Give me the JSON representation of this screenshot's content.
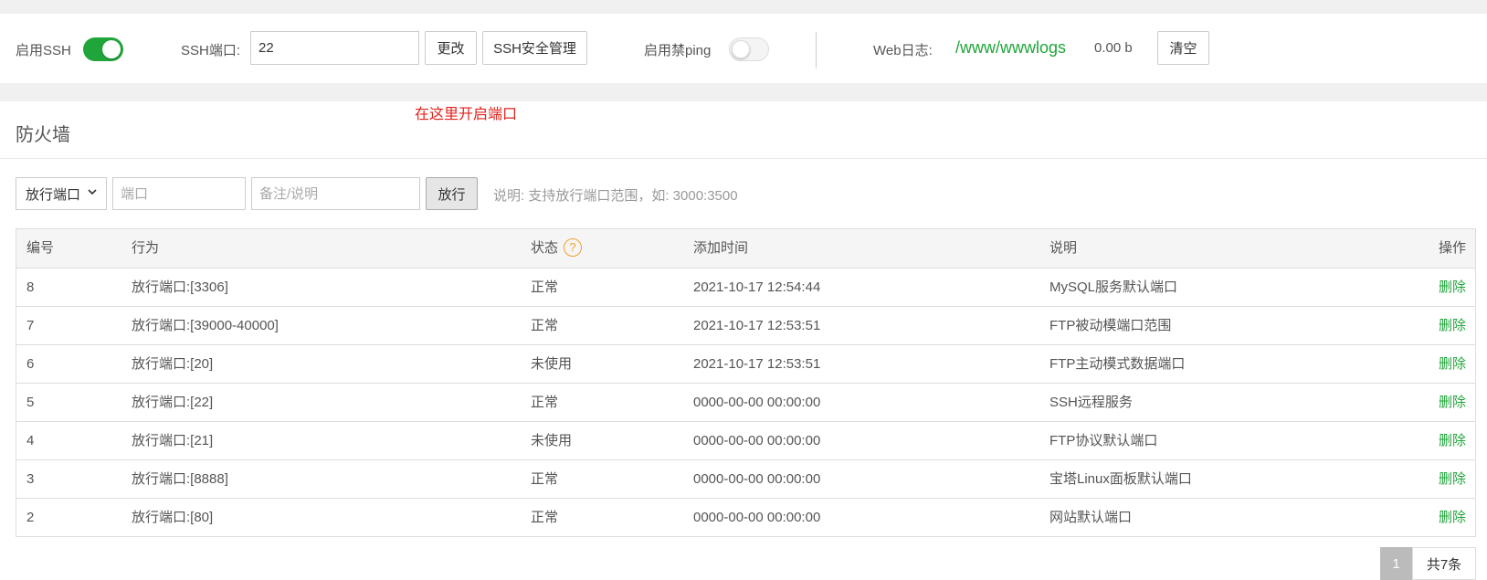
{
  "ssh": {
    "enable_label": "启用SSH",
    "enable_on": true,
    "port_label": "SSH端口:",
    "port_value": "22",
    "change_button": "更改",
    "security_button": "SSH安全管理",
    "ping_label": "启用禁ping",
    "ping_on": false,
    "weblog_label": "Web日志:",
    "weblog_path": "/www/wwwlogs",
    "weblog_size": "0.00 b",
    "clear_button": "清空"
  },
  "annotation": "在这里开启端口",
  "firewall": {
    "title": "防火墙",
    "mode_select": "放行端口",
    "port_placeholder": "端口",
    "remark_placeholder": "备注/说明",
    "submit_button": "放行",
    "note": "说明: 支持放行端口范围，如: 3000:3500"
  },
  "table": {
    "headers": [
      "编号",
      "行为",
      "状态",
      "添加时间",
      "说明",
      "操作"
    ],
    "rows": [
      {
        "id": "8",
        "action": "放行端口:[3306]",
        "status": "正常",
        "time": "2021-10-17 12:54:44",
        "desc": "MySQL服务默认端口",
        "op": "删除"
      },
      {
        "id": "7",
        "action": "放行端口:[39000-40000]",
        "status": "正常",
        "time": "2021-10-17 12:53:51",
        "desc": "FTP被动模端口范围",
        "op": "删除"
      },
      {
        "id": "6",
        "action": "放行端口:[20]",
        "status": "未使用",
        "time": "2021-10-17 12:53:51",
        "desc": "FTP主动模式数据端口",
        "op": "删除"
      },
      {
        "id": "5",
        "action": "放行端口:[22]",
        "status": "正常",
        "time": "0000-00-00 00:00:00",
        "desc": "SSH远程服务",
        "op": "删除"
      },
      {
        "id": "4",
        "action": "放行端口:[21]",
        "status": "未使用",
        "time": "0000-00-00 00:00:00",
        "desc": "FTP协议默认端口",
        "op": "删除"
      },
      {
        "id": "3",
        "action": "放行端口:[8888]",
        "status": "正常",
        "time": "0000-00-00 00:00:00",
        "desc": "宝塔Linux面板默认端口",
        "op": "删除"
      },
      {
        "id": "2",
        "action": "放行端口:[80]",
        "status": "正常",
        "time": "0000-00-00 00:00:00",
        "desc": "网站默认端口",
        "op": "删除"
      }
    ]
  },
  "pager": {
    "current": "1",
    "total": "共7条"
  },
  "colors": {
    "accent": "#20a53a",
    "annotation": "#e0231c",
    "help": "#f0a030"
  }
}
